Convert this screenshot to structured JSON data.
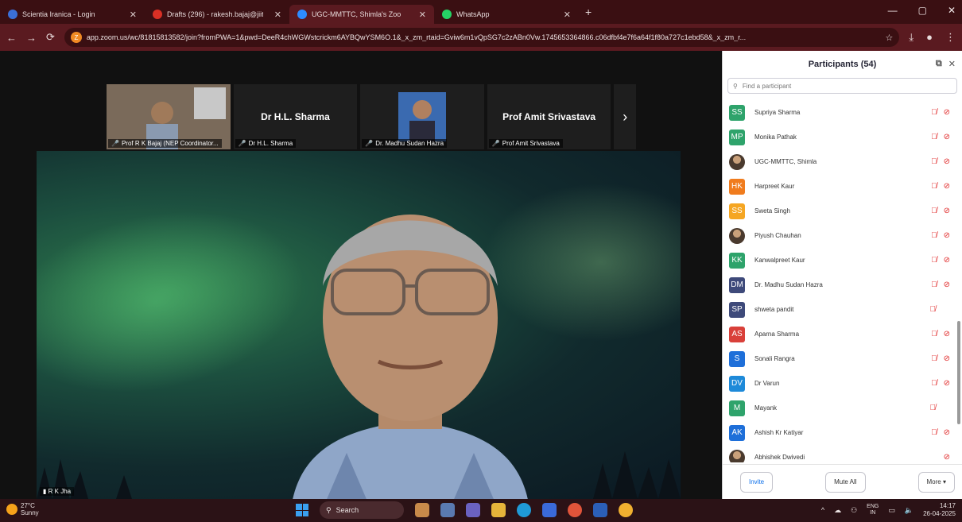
{
  "browser": {
    "tabs": [
      {
        "label": "Scientia Iranica - Login",
        "active": false,
        "color": "#3b6fd6"
      },
      {
        "label": "Drafts (296) - rakesh.bajaj@jiit",
        "active": false,
        "color": "#d93025"
      },
      {
        "label": "UGC-MMTTC, Shimla's Zoo",
        "active": true,
        "color": "#2d8cff"
      },
      {
        "label": "WhatsApp",
        "active": false,
        "color": "#25d366"
      }
    ],
    "url": "app.zoom.us/wc/81815813582/join?fromPWA=1&pwd=DeeR4chWGWstcrickm6AYBQwYSM6O.1&_x_zm_rtaid=Gviw6m1vQpSG7c2zABn0Vw.1745653364866.c06dfbf4e7f6a64f1f80a727c1ebd58&_x_zm_r..."
  },
  "thumbnails": [
    {
      "label": "Prof R K Bajaj (NEP Coordinator...",
      "type": "video"
    },
    {
      "label": "Dr H.L. Sharma",
      "big_name": "Dr H.L. Sharma",
      "type": "name"
    },
    {
      "label": "Dr. Madhu Sudan Hazra",
      "type": "video"
    },
    {
      "label": "Prof Amit Srivastava",
      "big_name": "Prof Amit Srivastava",
      "type": "name"
    }
  ],
  "main_video": {
    "label": "R K Jha"
  },
  "participants_panel": {
    "title": "Participants (54)",
    "search_placeholder": "Find a participant",
    "participants": [
      {
        "initials": "SS",
        "name": "Supriya Sharma",
        "color": "#2ea36b",
        "mic_off": true,
        "video_off": true
      },
      {
        "initials": "MP",
        "name": "Monika Pathak",
        "color": "#2ea36b",
        "mic_off": true,
        "video_off": true
      },
      {
        "initials": "",
        "name": "UGC-MMTTC, Shimla",
        "color": "#2b6b3a",
        "photo": true,
        "mic_off": true,
        "video_off": true
      },
      {
        "initials": "HK",
        "name": "Harpreet Kaur",
        "color": "#f07c1e",
        "mic_off": true,
        "video_off": true
      },
      {
        "initials": "SS",
        "name": "Sweta Singh",
        "color": "#f5a623",
        "mic_off": true,
        "video_off": true
      },
      {
        "initials": "",
        "name": "Piyush Chauhan",
        "color": "#6b4a2e",
        "photo": true,
        "mic_off": true,
        "video_off": true
      },
      {
        "initials": "KK",
        "name": "Kanwalpreet Kaur",
        "color": "#2ea36b",
        "mic_off": true,
        "video_off": true
      },
      {
        "initials": "DM",
        "name": "Dr. Madhu Sudan Hazra",
        "color": "#3e4a7a",
        "mic_off": true,
        "video_off": true
      },
      {
        "initials": "SP",
        "name": "shweta pandit",
        "color": "#3e4a7a",
        "mic_off": true,
        "video_off": false
      },
      {
        "initials": "AS",
        "name": "Aparna Sharma",
        "color": "#d9403a",
        "mic_off": true,
        "video_off": true
      },
      {
        "initials": "S",
        "name": "Sonali Rangra",
        "color": "#1e6fd9",
        "mic_off": true,
        "video_off": true
      },
      {
        "initials": "DV",
        "name": "Dr Varun",
        "color": "#1e8ad9",
        "mic_off": true,
        "video_off": true
      },
      {
        "initials": "M",
        "name": "Mayank",
        "color": "#2ea36b",
        "mic_off": true,
        "video_off": false
      },
      {
        "initials": "AK",
        "name": "Ashish Kr Katiyar",
        "color": "#1e6fd9",
        "mic_off": true,
        "video_off": true
      },
      {
        "initials": "",
        "name": "Abhishek Dwivedi",
        "color": "#8a6a4a",
        "photo": true,
        "mic_off": false,
        "video_off": true
      }
    ],
    "buttons": {
      "invite": "Invite",
      "mute_all": "Mute All",
      "more": "More"
    }
  },
  "taskbar": {
    "weather_temp": "27°C",
    "weather_desc": "Sunny",
    "search_label": "Search",
    "lang_top": "ENG",
    "lang_bottom": "IN",
    "time": "14:17",
    "date": "26-04-2025"
  }
}
